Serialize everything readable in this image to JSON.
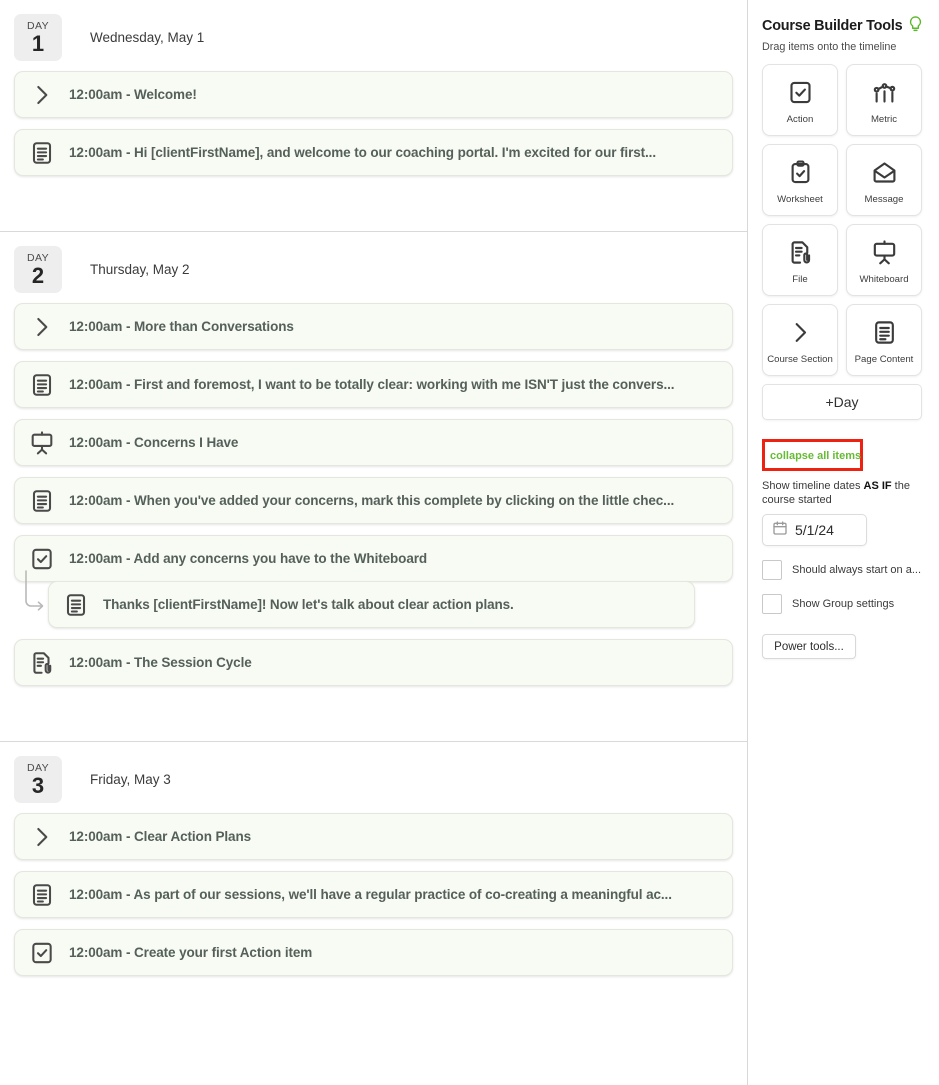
{
  "panel": {
    "title": "Course Builder Tools",
    "title_icon": "lightbulb-icon",
    "subtitle": "Drag items onto the timeline",
    "tools": [
      {
        "label": "Action",
        "icon": "checkbox-square-icon"
      },
      {
        "label": "Metric",
        "icon": "metric-chart-icon"
      },
      {
        "label": "Worksheet",
        "icon": "clipboard-check-icon"
      },
      {
        "label": "Message",
        "icon": "envelope-open-icon"
      },
      {
        "label": "File",
        "icon": "document-paperclip-icon"
      },
      {
        "label": "Whiteboard",
        "icon": "easel-icon"
      },
      {
        "label": "Course Section",
        "icon": "chevron-right-icon"
      },
      {
        "label": "Page Content",
        "icon": "page-lines-icon"
      }
    ],
    "add_day_label": "+Day",
    "collapse_all_label": "collapse all items",
    "collapse_all_color": "#66bb33",
    "highlight_color": "#ee2211",
    "asif_text_1": "Show timeline dates ",
    "asif_text_bold": "AS IF",
    "asif_text_2": " the course started",
    "date_value": "5/1/24",
    "date_icon": "calendar-icon",
    "checkboxes": [
      {
        "label": "Should always start on a...",
        "checked": false
      },
      {
        "label": "Show Group settings",
        "checked": false
      }
    ],
    "power_tools_label": "Power tools..."
  },
  "timeline": {
    "days": [
      {
        "day_label": "DAY",
        "day_number": "1",
        "date_text": "Wednesday, May 1",
        "items": [
          {
            "icon": "chevron-right-icon",
            "text": "12:00am - Welcome!",
            "nested": []
          },
          {
            "icon": "page-lines-icon",
            "text": "12:00am - Hi [clientFirstName], and welcome to our coaching portal.  I'm excited for our first...",
            "nested": []
          }
        ]
      },
      {
        "day_label": "DAY",
        "day_number": "2",
        "date_text": "Thursday, May 2",
        "items": [
          {
            "icon": "chevron-right-icon",
            "text": "12:00am - More than Conversations",
            "nested": []
          },
          {
            "icon": "page-lines-icon",
            "text": "12:00am - First and foremost, I want to be totally clear: working with me ISN'T just the convers...",
            "nested": []
          },
          {
            "icon": "easel-icon",
            "text": "12:00am - Concerns I Have",
            "nested": []
          },
          {
            "icon": "page-lines-icon",
            "text": "12:00am - When you've added your concerns, mark this complete by clicking on the little chec...",
            "nested": []
          },
          {
            "icon": "checkbox-square-icon",
            "text": "12:00am - Add any concerns you have to the Whiteboard",
            "nested": [
              {
                "icon": "page-lines-icon",
                "text": "Thanks [clientFirstName]!  Now let's talk about clear action plans."
              }
            ]
          },
          {
            "icon": "document-paperclip-icon",
            "text": "12:00am - The Session Cycle",
            "nested": []
          }
        ]
      },
      {
        "day_label": "DAY",
        "day_number": "3",
        "date_text": "Friday, May 3",
        "items": [
          {
            "icon": "chevron-right-icon",
            "text": "12:00am - Clear Action Plans",
            "nested": []
          },
          {
            "icon": "page-lines-icon",
            "text": "12:00am - As part of our sessions, we'll have a regular practice of co-creating a meaningful ac...",
            "nested": []
          },
          {
            "icon": "checkbox-square-icon",
            "text": "12:00am - Create your first Action item",
            "nested": []
          }
        ]
      }
    ]
  }
}
